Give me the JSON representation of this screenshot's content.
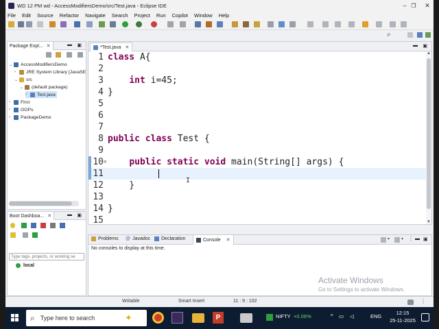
{
  "window": {
    "title": "WD 12 PM  wd - AccessModifiersDemo/src/Test.java - Eclipse IDE",
    "minimize": "–",
    "restore": "❐",
    "close": "✕"
  },
  "menu": [
    "File",
    "Edit",
    "Source",
    "Refactor",
    "Navigate",
    "Search",
    "Project",
    "Run",
    "Copilot",
    "Window",
    "Help"
  ],
  "package_explorer": {
    "tab_label": "Package Expl...",
    "tree": [
      {
        "label": "AccessModifiersDemo",
        "level": 0,
        "expanded": true,
        "icon": "project-icon"
      },
      {
        "label": "JRE System Library [JavaSE",
        "level": 1,
        "expanded": false,
        "icon": "library-icon"
      },
      {
        "label": "src",
        "level": 1,
        "expanded": true,
        "icon": "folder-icon"
      },
      {
        "label": "(default package)",
        "level": 2,
        "expanded": true,
        "icon": "package-icon"
      },
      {
        "label": "Test.java",
        "level": 3,
        "expanded": false,
        "icon": "java-file-icon",
        "selected": true
      },
      {
        "label": "First",
        "level": 0,
        "expanded": false,
        "icon": "project-icon"
      },
      {
        "label": "OOPs",
        "level": 0,
        "expanded": false,
        "icon": "project-icon"
      },
      {
        "label": "PackageDemo",
        "level": 0,
        "expanded": false,
        "icon": "project-icon"
      }
    ]
  },
  "boot_dashboard": {
    "tab_label": "Boot Dashboa...",
    "filter_placeholder": "Type tags, projects, or working se",
    "items": [
      "local"
    ]
  },
  "editor": {
    "tab_label": "*Test.java",
    "lines": [
      {
        "n": "1",
        "text": "class A{"
      },
      {
        "n": "2",
        "text": ""
      },
      {
        "n": "3",
        "text": "    int i=45;"
      },
      {
        "n": "4",
        "text": "}"
      },
      {
        "n": "5",
        "text": ""
      },
      {
        "n": "6",
        "text": ""
      },
      {
        "n": "7",
        "text": ""
      },
      {
        "n": "8",
        "text": "public class Test {"
      },
      {
        "n": "9",
        "text": ""
      },
      {
        "n": "10",
        "text": "    public static void main(String[] args) {"
      },
      {
        "n": "11",
        "text": ""
      },
      {
        "n": "12",
        "text": "    }"
      },
      {
        "n": "13",
        "text": ""
      },
      {
        "n": "14",
        "text": "}"
      },
      {
        "n": "15",
        "text": ""
      }
    ]
  },
  "bottom_panel": {
    "tabs": [
      "Problems",
      "Javadoc",
      "Declaration",
      "Console"
    ],
    "console_message": "No consoles to display at this time."
  },
  "status": {
    "writable": "Writable",
    "insert_mode": "Smart Insert",
    "position": "11 : 9 : 102"
  },
  "watermark": {
    "title": "Activate Windows",
    "subtitle": "Go to Settings to activate Windows."
  },
  "taskbar": {
    "search_placeholder": "Type here to search",
    "stock_label": "NIFTY",
    "stock_change": "+0.06%",
    "language": "ENG",
    "time": "12:15",
    "date": "25-11-2025"
  }
}
